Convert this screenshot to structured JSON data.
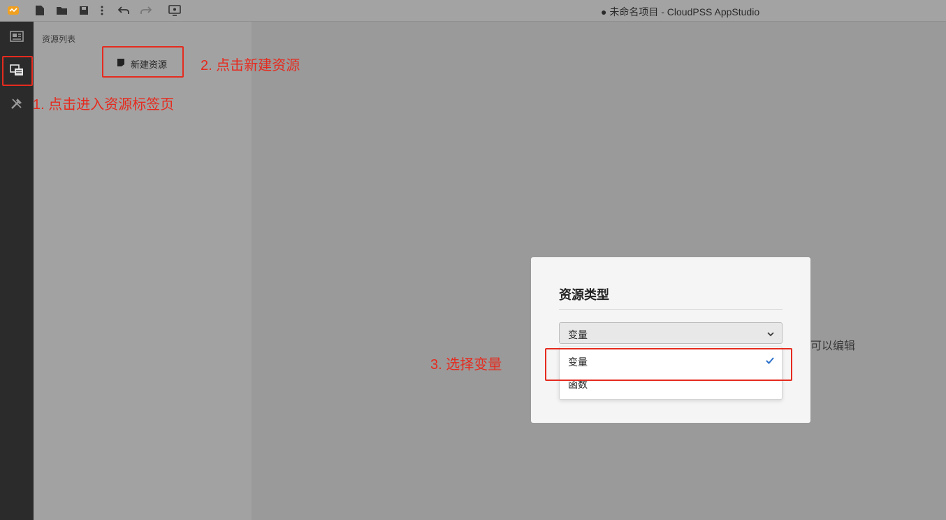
{
  "window": {
    "title": "● 未命名项目 - CloudPSS AppStudio"
  },
  "toolbar": {
    "icons": [
      "app-logo-icon",
      "new-file-icon",
      "open-folder-icon",
      "save-icon",
      "more-vertical-icon",
      "undo-icon",
      "redo-icon",
      "preview-icon"
    ]
  },
  "activitybar": {
    "items": [
      "layout-icon",
      "resources-icon",
      "tools-icon"
    ]
  },
  "sidepanel": {
    "title": "资源列表",
    "new_resource_label": "新建资源"
  },
  "main": {
    "hint_fragment": "可以编辑"
  },
  "dialog": {
    "title": "资源类型",
    "select_value": "变量",
    "options": [
      {
        "label": "变量",
        "selected": true
      },
      {
        "label": "函数",
        "selected": false
      }
    ]
  },
  "annotations": {
    "step1": "1. 点击进入资源标签页",
    "step2": "2. 点击新建资源",
    "step3": "3. 选择变量",
    "color": "#e52b1f"
  },
  "colors": {
    "activitybar": "#2b2b2b",
    "accent_check": "#2a6fc9"
  }
}
